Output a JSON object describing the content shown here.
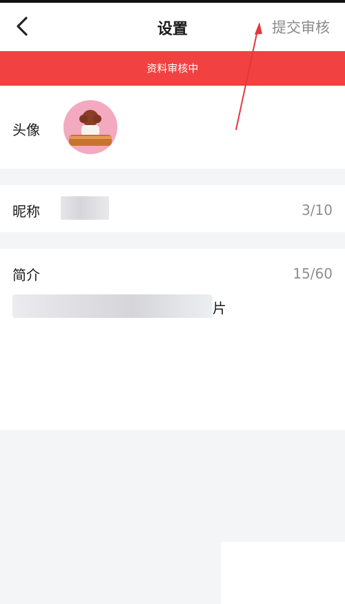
{
  "header": {
    "title": "设置",
    "submit_label": "提交审核"
  },
  "banner": {
    "text": "资料审核中"
  },
  "avatar": {
    "label": "头像"
  },
  "nickname": {
    "label": "昵称",
    "count": "3/10"
  },
  "bio": {
    "label": "简介",
    "count": "15/60",
    "visible_tail": "片"
  },
  "colors": {
    "banner": "#f24141",
    "arrow": "#e4373a"
  }
}
